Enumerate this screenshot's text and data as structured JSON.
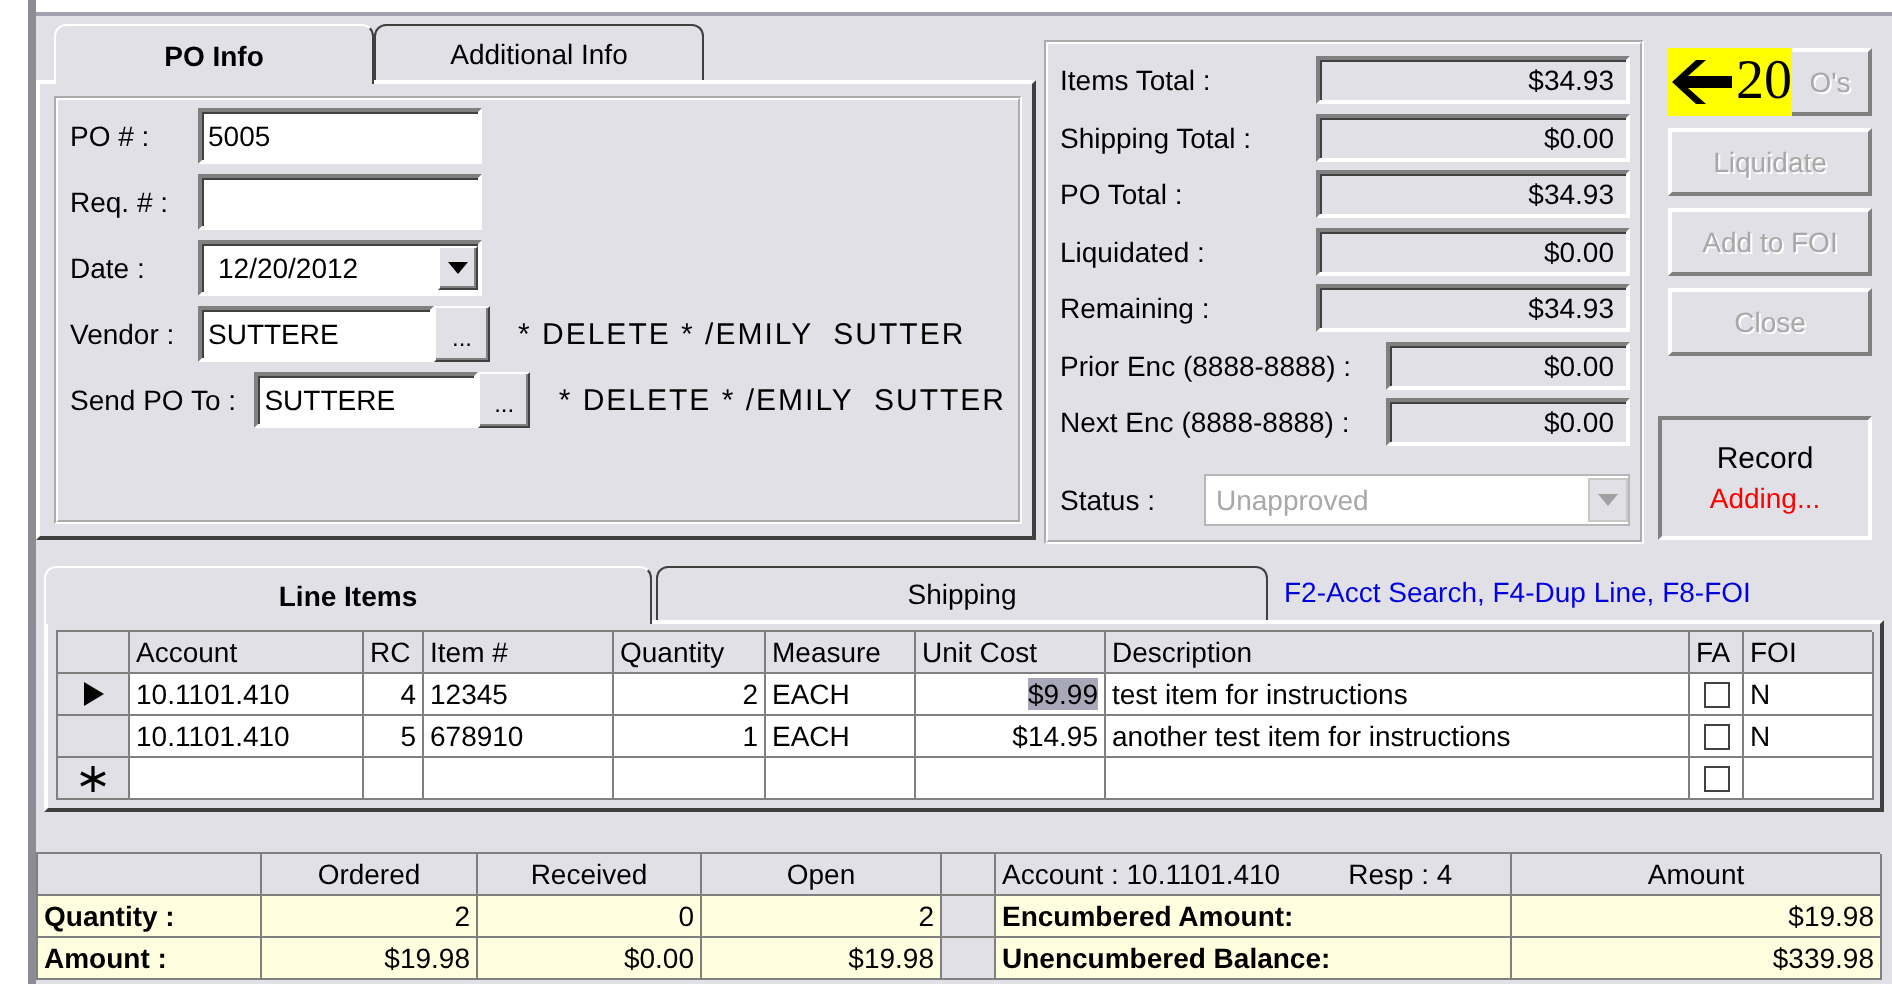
{
  "po_tabs": [
    {
      "label": "PO Info",
      "selected": true
    },
    {
      "label": "Additional Info",
      "selected": false
    }
  ],
  "po_fields": [
    {
      "kind": "text",
      "label": "PO # :",
      "value": "5005"
    },
    {
      "kind": "text",
      "label": "Req. # :"
    },
    {
      "kind": "date",
      "label": "Date :",
      "value": "12/20/2012"
    },
    {
      "kind": "lookup",
      "label": "Vendor :",
      "value": "SUTTERE",
      "button": "...",
      "note": "* DELETE * /EMILY  SUTTER"
    },
    {
      "kind": "lookup",
      "label": "Send PO To :",
      "value": "SUTTERE",
      "button": "...",
      "note": "* DELETE * /EMILY  SUTTER"
    }
  ],
  "totals": [
    {
      "label": "Items Total :",
      "value": "$34.93",
      "kind": "wide"
    },
    {
      "label": "Shipping Total :",
      "value": "$0.00",
      "kind": "wide"
    },
    {
      "label": "PO Total :",
      "value": "$34.93",
      "kind": "wide"
    },
    {
      "label": "Liquidated :",
      "value": "$0.00",
      "kind": "wide"
    },
    {
      "label": "Remaining :",
      "value": "$34.93",
      "kind": "wide"
    },
    {
      "label": "Prior Enc (8888-8888) :",
      "value": "$0.00",
      "kind": "narrow"
    },
    {
      "label": "Next Enc (8888-8888) :",
      "value": "$0.00",
      "kind": "narrow"
    }
  ],
  "status": {
    "label": "Status :",
    "value": "Unapproved",
    "disabled": true
  },
  "buttons": [
    {
      "label": "O's",
      "disabled": true
    },
    {
      "label": "Liquidate",
      "disabled": true
    },
    {
      "label": "Add to FOI",
      "disabled": true
    },
    {
      "label": "Close",
      "disabled": true
    }
  ],
  "callout": {
    "text": "20"
  },
  "record": {
    "title": "Record",
    "state": "Adding..."
  },
  "line_tabs": [
    {
      "label": "Line Items",
      "selected": true
    },
    {
      "label": "Shipping",
      "selected": false
    }
  ],
  "shortcut_hint": "F2-Acct Search, F4-Dup Line, F8-FOI",
  "line_items": {
    "columns": [
      "Account",
      "RC",
      "Item #",
      "Quantity",
      "Measure",
      "Unit Cost",
      "Description",
      "FA",
      "FOI"
    ],
    "rows": [
      {
        "kind": "current",
        "cells": [
          "10.1101.410",
          "4",
          "12345",
          "2",
          "EACH",
          "$9.99",
          "test item for instructions"
        ],
        "cost_selected": true,
        "fa_checked": false,
        "foi": "N"
      },
      {
        "kind": "plain",
        "cells": [
          "10.1101.410",
          "5",
          "678910",
          "1",
          "EACH",
          "$14.95",
          "another test item for instructions"
        ],
        "fa_checked": false,
        "foi": "N"
      },
      {
        "kind": "new",
        "cells": [
          "",
          "",
          "",
          "",
          "",
          "",
          ""
        ],
        "fa_checked": false
      }
    ]
  },
  "summary": {
    "columns": [
      "Ordered",
      "Received",
      "Open"
    ],
    "rows": [
      {
        "label": "Quantity :",
        "values": [
          "2",
          "0",
          "2"
        ]
      },
      {
        "label": "Amount :",
        "values": [
          "$19.98",
          "$0.00",
          "$19.98"
        ]
      }
    ]
  },
  "account_summary": {
    "account": "Account : 10.1101.410",
    "resp": "Resp : 4",
    "amount_heading": "Amount",
    "rows": [
      {
        "label": "Encumbered Amount:",
        "value": "$19.98"
      },
      {
        "label": "Unencumbered Balance:",
        "value": "$339.98"
      }
    ]
  }
}
